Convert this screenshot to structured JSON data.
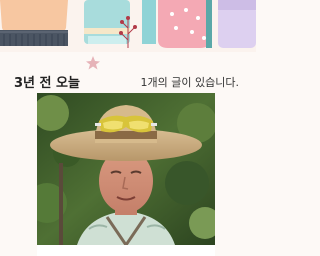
{
  "memory": {
    "title": "3년 전 오늘",
    "count_text": "1개의 글이 있습니다."
  },
  "colors": {
    "background": "#fdf9f6",
    "accent_pink": "#f4b0b9",
    "accent_orange": "#f6c39b",
    "accent_teal": "#8fd3d6",
    "accent_lavender": "#d9c9ee",
    "title_text": "#222222"
  },
  "icons": {
    "star": "star-decoration-icon",
    "branch": "branch-decoration-icon"
  }
}
